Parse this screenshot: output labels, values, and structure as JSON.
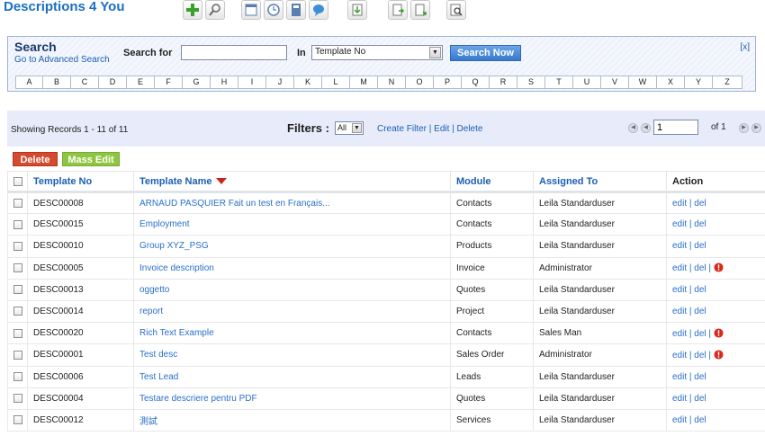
{
  "app": {
    "title": "Descriptions 4 You"
  },
  "toolbar": {
    "icons": [
      "add-icon",
      "search-icon",
      "calendar-icon",
      "clock-icon",
      "calculator-icon",
      "chat-icon",
      "import-icon",
      "export-icon",
      "export-alt-icon",
      "find-duplicates-icon"
    ]
  },
  "search": {
    "title": "Search",
    "advanced_link": "Go to Advanced Search",
    "search_for_label": "Search for",
    "search_value": "",
    "in_label": "In",
    "in_value": "Template No",
    "button_label": "Search Now",
    "close_label": "[x]",
    "alphabet": [
      "A",
      "B",
      "C",
      "D",
      "E",
      "F",
      "G",
      "H",
      "I",
      "J",
      "K",
      "L",
      "M",
      "N",
      "O",
      "P",
      "Q",
      "R",
      "S",
      "T",
      "U",
      "V",
      "W",
      "X",
      "Y",
      "Z"
    ]
  },
  "records": {
    "showing": "Showing Records 1 - 11 of 11",
    "filters_label": "Filters :",
    "filter_value": "All",
    "filter_links": "Create Filter | Edit | Delete",
    "page_value": "1",
    "page_of": "of 1"
  },
  "actions": {
    "delete_label": "Delete",
    "mass_edit_label": "Mass Edit"
  },
  "table": {
    "headers": {
      "template_no": "Template No",
      "template_name": "Template Name",
      "module": "Module",
      "assigned_to": "Assigned To",
      "action": "Action"
    },
    "rows": [
      {
        "no": "DESC00008",
        "name": "ARNAUD PASQUIER Fait un test en Français...",
        "module": "Contacts",
        "assigned": "Leila Standarduser",
        "action": "edit | del",
        "warn": false
      },
      {
        "no": "DESC00015",
        "name": "Employment",
        "module": "Contacts",
        "assigned": "Leila Standarduser",
        "action": "edit | del",
        "warn": false
      },
      {
        "no": "DESC00010",
        "name": "Group XYZ_PSG",
        "module": "Products",
        "assigned": "Leila Standarduser",
        "action": "edit | del",
        "warn": false
      },
      {
        "no": "DESC00005",
        "name": "Invoice description",
        "module": "Invoice",
        "assigned": "Administrator",
        "action": "edit | del |",
        "warn": true
      },
      {
        "no": "DESC00013",
        "name": "oggetto",
        "module": "Quotes",
        "assigned": "Leila Standarduser",
        "action": "edit | del",
        "warn": false
      },
      {
        "no": "DESC00014",
        "name": "report",
        "module": "Project",
        "assigned": "Leila Standarduser",
        "action": "edit | del",
        "warn": false
      },
      {
        "no": "DESC00020",
        "name": "Rich Text Example",
        "module": "Contacts",
        "assigned": "Sales Man",
        "action": "edit | del |",
        "warn": true
      },
      {
        "no": "DESC00001",
        "name": "Test desc",
        "module": "Sales Order",
        "assigned": "Administrator",
        "action": "edit | del |",
        "warn": true
      },
      {
        "no": "DESC00006",
        "name": "Test Lead",
        "module": "Leads",
        "assigned": "Leila Standarduser",
        "action": "edit | del",
        "warn": false
      },
      {
        "no": "DESC00004",
        "name": "Testare descriere pentru PDF",
        "module": "Quotes",
        "assigned": "Leila Standarduser",
        "action": "edit | del",
        "warn": false
      },
      {
        "no": "DESC00012",
        "name": "測試",
        "module": "Services",
        "assigned": "Leila Standarduser",
        "action": "edit | del",
        "warn": false
      }
    ]
  },
  "colors": {
    "brand": "#1a6fc4",
    "delete": "#d44a2e",
    "mass_edit": "#8fc641",
    "search_btn": "#3879cf"
  }
}
